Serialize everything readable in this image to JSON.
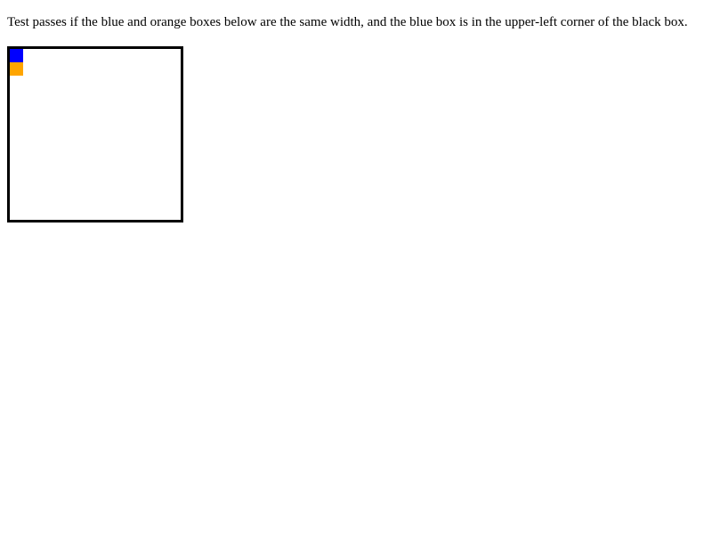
{
  "description": "Test passes if the blue and orange boxes below are the same width, and the blue box is in the upper-left corner of the black box.",
  "colors": {
    "blue": "#0000ff",
    "orange": "#ffa500",
    "border": "#000000"
  }
}
